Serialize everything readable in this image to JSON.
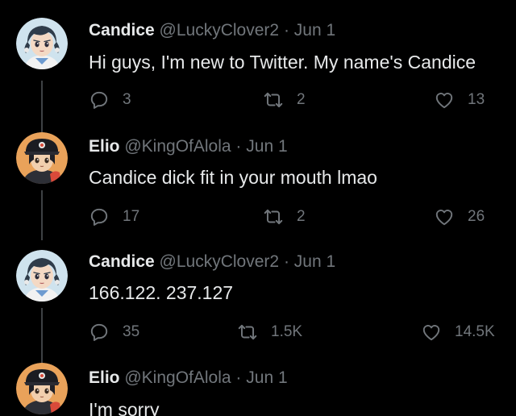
{
  "colors": {
    "background": "#000000",
    "text": "#e7e9ea",
    "muted": "#71767b",
    "thread_line": "#3e4144"
  },
  "tweets": [
    {
      "name": "Candice",
      "handle": "@LuckyClover2",
      "date": "Jun 1",
      "separator": "·",
      "text": "Hi guys, I'm new to Twitter. My name's Candice",
      "replies": "3",
      "retweets": "2",
      "likes": "13",
      "avatar": "candice-avatar"
    },
    {
      "name": "Elio",
      "handle": "@KingOfAlola",
      "date": "Jun 1",
      "separator": "·",
      "text": "Candice dick fit in your mouth lmao",
      "replies": "17",
      "retweets": "2",
      "likes": "26",
      "avatar": "elio-avatar"
    },
    {
      "name": "Candice",
      "handle": "@LuckyClover2",
      "date": "Jun 1",
      "separator": "·",
      "text": "166.122. 237.127",
      "replies": "35",
      "retweets": "1.5K",
      "likes": "14.5K",
      "avatar": "candice-avatar"
    },
    {
      "name": "Elio",
      "handle": "@KingOfAlola",
      "date": "Jun 1",
      "separator": "·",
      "text": "I'm sorry",
      "avatar": "elio-avatar"
    }
  ]
}
